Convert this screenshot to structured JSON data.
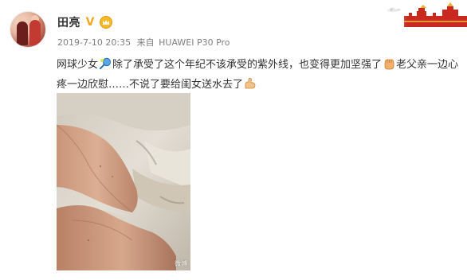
{
  "user": {
    "name": "田亮"
  },
  "meta": {
    "timestamp": "2019-7-10 20:35",
    "source_prefix": "来自",
    "device": "HUAWEI P30 Pro"
  },
  "post": {
    "text_1": "网球少女",
    "text_2": "除了承受了这个年纪不该承受的紫外线，也变得更加坚强了",
    "text_3": "老父亲一边心疼一边欣慰……不说了要给闺女送水去了",
    "emojis": [
      "tennis-racket-emoji",
      "raised-fist-emoji",
      "flexed-biceps-emoji"
    ]
  },
  "photo": {
    "watermark": "微博"
  },
  "colors": {
    "username": "#333333",
    "meta": "#808080",
    "text": "#333333",
    "verify": "#f5a623"
  }
}
